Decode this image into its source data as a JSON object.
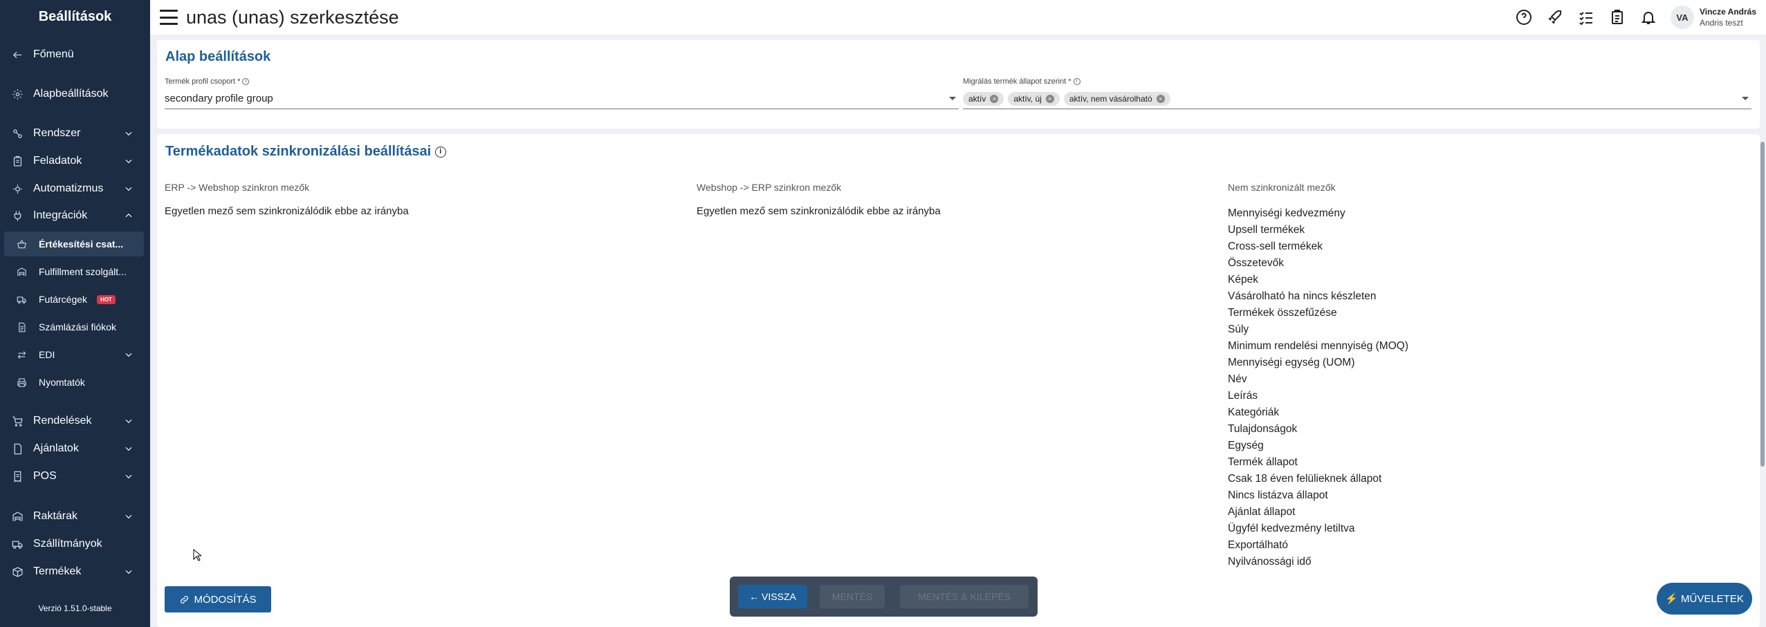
{
  "sidebar": {
    "title": "Beállítások",
    "items": [
      {
        "label": "Főmenü",
        "icon": "arrow-left-icon"
      },
      {
        "label": "Alapbeállítások",
        "icon": "gear-icon"
      },
      {
        "label": "Rendszer",
        "icon": "system-icon"
      },
      {
        "label": "Feladatok",
        "icon": "clipboard-icon"
      },
      {
        "label": "Automatizmus",
        "icon": "gear-cog-icon"
      },
      {
        "label": "Integrációk",
        "icon": "plug-icon"
      },
      {
        "label": "Értékesítési csat...",
        "icon": "basket-icon"
      },
      {
        "label": "Fulfillment szolgált...",
        "icon": "warehouse-icon"
      },
      {
        "label": "Futárcégek",
        "icon": "truck-icon",
        "badge": "HOT"
      },
      {
        "label": "Számlázási fiókok",
        "icon": "document-icon"
      },
      {
        "label": "EDI",
        "icon": "swap-icon"
      },
      {
        "label": "Nyomtatók",
        "icon": "printer-icon"
      },
      {
        "label": "Rendelések",
        "icon": "cart-icon"
      },
      {
        "label": "Ajánlatok",
        "icon": "file-icon"
      },
      {
        "label": "POS",
        "icon": "receipt-icon"
      },
      {
        "label": "Raktárak",
        "icon": "warehouse-icon"
      },
      {
        "label": "Szállítmányok",
        "icon": "truck-icon"
      },
      {
        "label": "Termékek",
        "icon": "box-icon"
      }
    ],
    "version": "Verzió 1.51.0-stable"
  },
  "topbar": {
    "title": "unas (unas) szerkesztése",
    "user_initials": "VA",
    "user_name": "Vincze András",
    "user_company": "Andris teszt"
  },
  "basic": {
    "title": "Alap beállítások",
    "profile_label": "Termék profil csoport *",
    "profile_value": "secondary profile group",
    "migration_label": "Migrálás termék állapot szerint *",
    "chips": [
      "aktív",
      "aktív, új",
      "aktív, nem vásárolható"
    ]
  },
  "sync": {
    "title": "Termékadatok szinkronizálási beállításai",
    "col1_head": "ERP -> Webshop szinkron mezők",
    "col1_text": "Egyetlen mező sem szinkronizálódik ebbe az irányba",
    "col2_head": "Webshop -> ERP szinkron mezők",
    "col2_text": "Egyetlen mező sem szinkronizálódik ebbe az irányba",
    "col3_head": "Nem szinkronizált mezők",
    "not_synced": [
      "Mennyiségi kedvezmény",
      "Upsell termékek",
      "Cross-sell termékek",
      "Összetevők",
      "Képek",
      "Vásárolható ha nincs készleten",
      "Termékek összefűzése",
      "Súly",
      "Minimum rendelési mennyiség (MOQ)",
      "Mennyiségi egység (UOM)",
      "Név",
      "Leírás",
      "Kategóriák",
      "Tulajdonságok",
      "Egység",
      "Termék állapot",
      "Csak 18 éven felülieknek állapot",
      "Nincs listázva állapot",
      "Ajánlat állapot",
      "Ügyfél kedvezmény letiltva",
      "Exportálható",
      "Nyilvánossági idő"
    ]
  },
  "buttons": {
    "modify": "MÓDOSÍTÁS",
    "back": "← VISSZA",
    "save": "MENTÉS",
    "save_exit": "MENTÉS & KILÉPÉS",
    "actions": "⚡ MŰVELETEK"
  }
}
